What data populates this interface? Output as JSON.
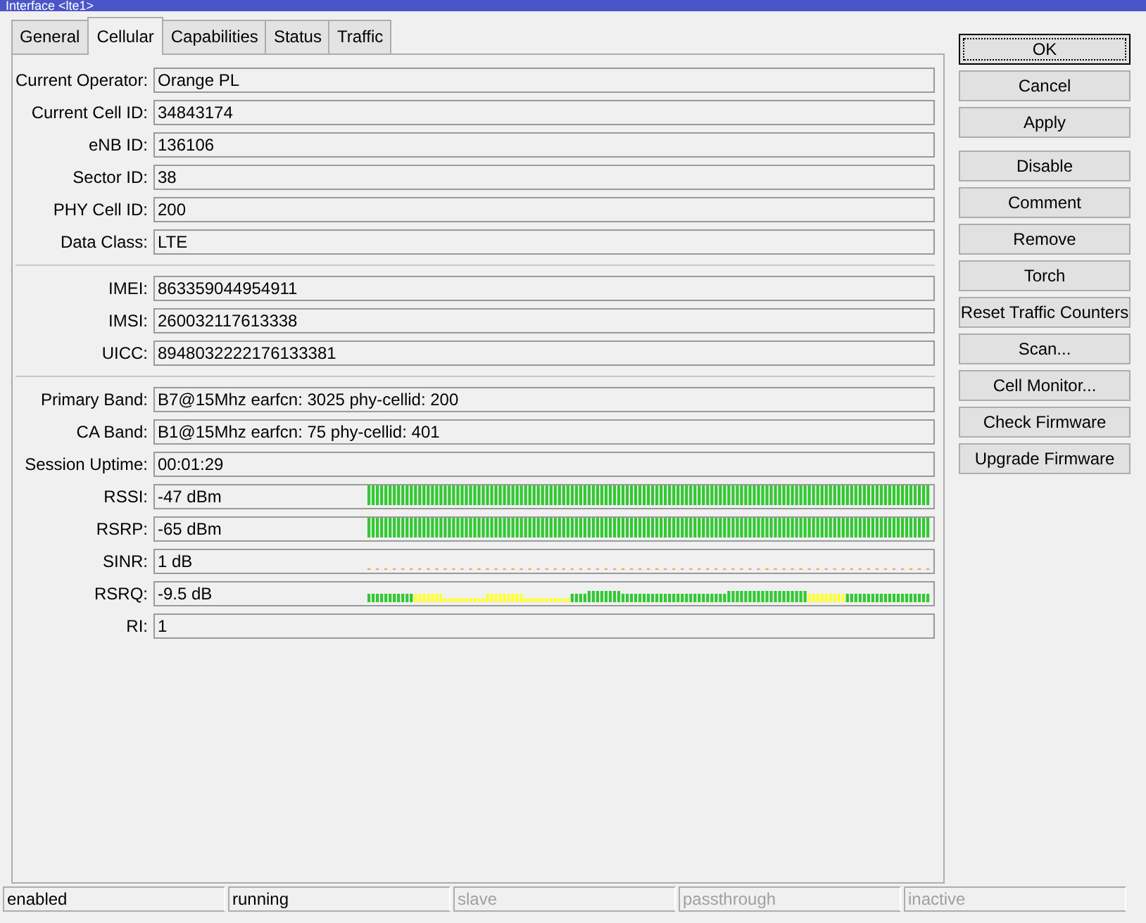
{
  "window": {
    "title": "Interface <lte1>"
  },
  "tabs": [
    {
      "label": "General",
      "selected": false
    },
    {
      "label": "Cellular",
      "selected": true
    },
    {
      "label": "Capabilities",
      "selected": false
    },
    {
      "label": "Status",
      "selected": false
    },
    {
      "label": "Traffic",
      "selected": false
    }
  ],
  "groups": [
    {
      "fields": [
        {
          "kind": "text",
          "label": "Current Operator:",
          "value": "Orange PL"
        },
        {
          "kind": "text",
          "label": "Current Cell ID:",
          "value": "34843174"
        },
        {
          "kind": "text",
          "label": "eNB ID:",
          "value": "136106"
        },
        {
          "kind": "text",
          "label": "Sector ID:",
          "value": "38"
        },
        {
          "kind": "text",
          "label": "PHY Cell ID:",
          "value": "200"
        },
        {
          "kind": "text",
          "label": "Data Class:",
          "value": "LTE"
        }
      ]
    },
    {
      "fields": [
        {
          "kind": "text",
          "label": "IMEI:",
          "value": "863359044954911"
        },
        {
          "kind": "text",
          "label": "IMSI:",
          "value": "260032117613338"
        },
        {
          "kind": "text",
          "label": "UICC:",
          "value": "8948032222176133381"
        }
      ]
    },
    {
      "fields": [
        {
          "kind": "text",
          "label": "Primary Band:",
          "value": "B7@15Mhz earfcn: 3025 phy-cellid: 200"
        },
        {
          "kind": "text",
          "label": "CA Band:",
          "value": "B1@15Mhz earfcn: 75 phy-cellid: 401"
        },
        {
          "kind": "text",
          "label": "Session Uptime:",
          "value": "00:01:29"
        },
        {
          "kind": "fullgraph",
          "label": "RSSI:",
          "value": "-47 dBm"
        },
        {
          "kind": "fullgraph",
          "label": "RSRP:",
          "value": "-65 dBm"
        },
        {
          "kind": "lowgraph",
          "label": "SINR:",
          "value": "1 dB"
        },
        {
          "kind": "mixedgraph",
          "label": "RSRQ:",
          "value": "-9.5 dB"
        },
        {
          "kind": "text",
          "label": "RI:",
          "value": "1"
        }
      ]
    }
  ],
  "button_groups": [
    [
      {
        "label": "OK",
        "focused": true
      },
      {
        "label": "Cancel",
        "focused": false
      },
      {
        "label": "Apply",
        "focused": false
      }
    ],
    [
      {
        "label": "Disable",
        "focused": false
      },
      {
        "label": "Comment",
        "focused": false
      },
      {
        "label": "Remove",
        "focused": false
      },
      {
        "label": "Torch",
        "focused": false
      },
      {
        "label": "Reset Traffic Counters",
        "focused": false
      },
      {
        "label": "Scan...",
        "focused": false
      },
      {
        "label": "Cell Monitor...",
        "focused": false
      },
      {
        "label": "Check Firmware",
        "focused": false
      },
      {
        "label": "Upgrade Firmware",
        "focused": false
      }
    ]
  ],
  "status_bar": [
    {
      "text": "enabled",
      "disabled": false
    },
    {
      "text": "running",
      "disabled": false
    },
    {
      "text": "slave",
      "disabled": true
    },
    {
      "text": "passthrough",
      "disabled": true
    },
    {
      "text": "inactive",
      "disabled": true
    }
  ]
}
